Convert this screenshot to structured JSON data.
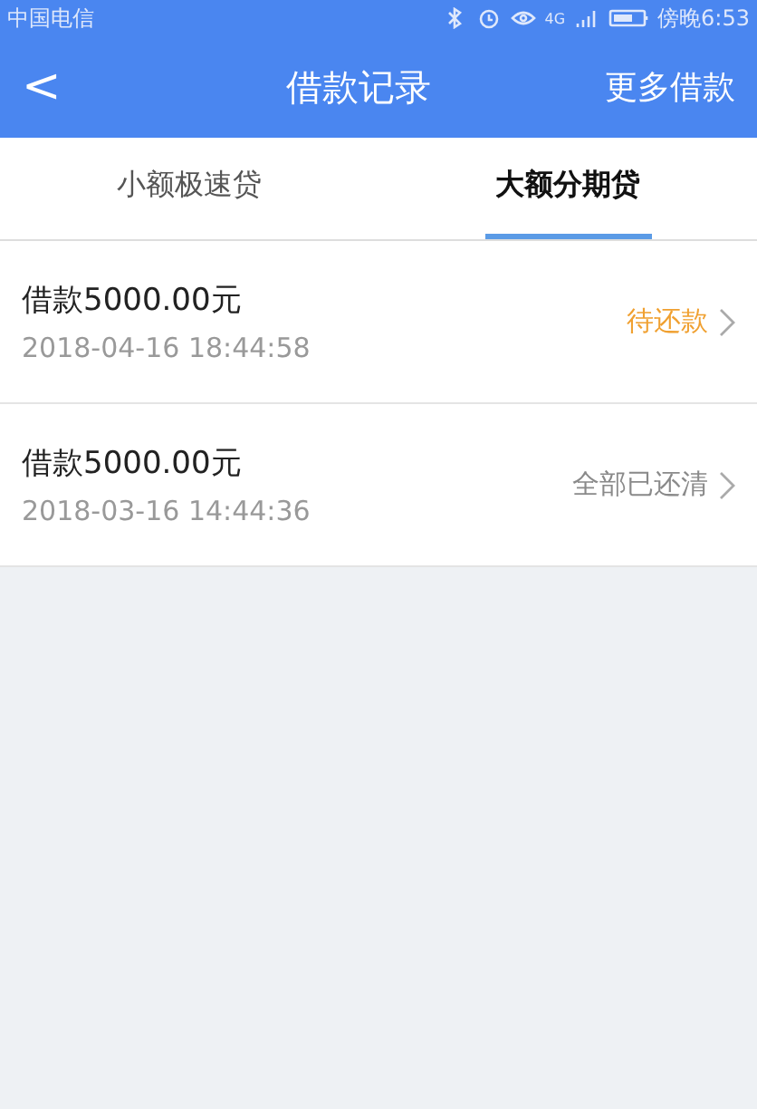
{
  "status_bar": {
    "carrier": "中国电信",
    "network": "4G",
    "time": "傍晚6:53"
  },
  "header": {
    "back": "<",
    "title": "借款记录",
    "action": "更多借款"
  },
  "tabs": [
    {
      "label": "小额极速贷",
      "selected": false
    },
    {
      "label": "大额分期贷",
      "selected": true
    }
  ],
  "records": [
    {
      "amount": "借款5000.00元",
      "time": "2018-04-16 18:44:58",
      "status": "待还款",
      "color": "#f0a030"
    },
    {
      "amount": "借款5000.00元",
      "time": "2018-03-16 14:44:36",
      "status": "全部已还清",
      "color": "#8a8a8a"
    }
  ]
}
